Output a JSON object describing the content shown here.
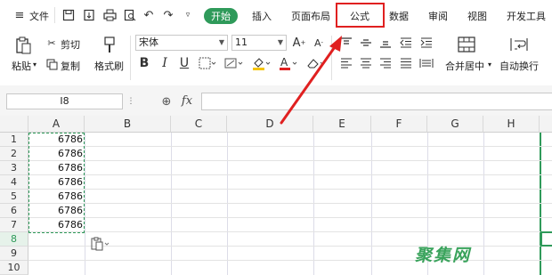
{
  "tabs": {
    "file": "文件",
    "start": "开始",
    "insert": "插入",
    "page_layout": "页面布局",
    "formula": "公式",
    "data": "数据",
    "review": "审阅",
    "view": "视图",
    "developer": "开发工具"
  },
  "toolbar": {
    "paste": "粘贴",
    "cut": "剪切",
    "copy": "复制",
    "format_painter": "格式刷",
    "font_name": "宋体",
    "font_size": "11",
    "merge_center": "合并居中",
    "wrap_text": "自动换行"
  },
  "formula_bar": {
    "name_box": "I8",
    "fx_label": "fx",
    "zoom_icon": "⊕"
  },
  "grid": {
    "columns": [
      "A",
      "B",
      "C",
      "D",
      "E",
      "F",
      "G",
      "H"
    ],
    "rows": [
      "1",
      "2",
      "3",
      "4",
      "5",
      "6",
      "7",
      "8",
      "9",
      "10"
    ],
    "column_a_values": [
      "6786",
      "6786",
      "6786",
      "6786",
      "6786",
      "6786",
      "6786"
    ]
  },
  "watermark": "聚集网",
  "colors": {
    "accent_green": "#2f9a5a",
    "highlight_red": "#e02020"
  }
}
